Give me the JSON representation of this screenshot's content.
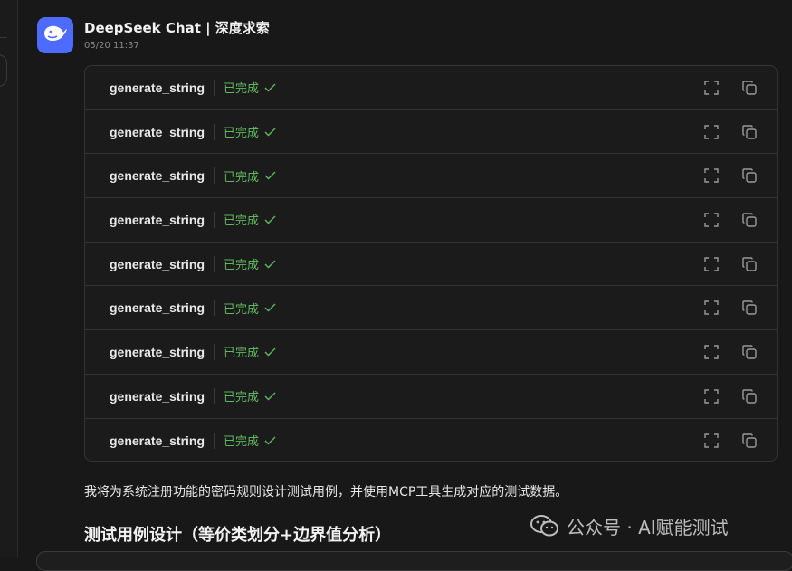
{
  "header": {
    "title": "DeepSeek Chat | 深度求索",
    "timestamp": "05/20 11:37"
  },
  "tool_calls": [
    {
      "name": "generate_string",
      "status": "已完成"
    },
    {
      "name": "generate_string",
      "status": "已完成"
    },
    {
      "name": "generate_string",
      "status": "已完成"
    },
    {
      "name": "generate_string",
      "status": "已完成"
    },
    {
      "name": "generate_string",
      "status": "已完成"
    },
    {
      "name": "generate_string",
      "status": "已完成"
    },
    {
      "name": "generate_string",
      "status": "已完成"
    },
    {
      "name": "generate_string",
      "status": "已完成"
    },
    {
      "name": "generate_string",
      "status": "已完成"
    }
  ],
  "message": {
    "paragraph": "我将为系统注册功能的密码规则设计测试用例，并使用MCP工具生成对应的测试数据。",
    "heading": "测试用例设计（等价类划分+边界值分析）"
  },
  "watermark": {
    "text": "公众号 · AI赋能测试"
  },
  "colors": {
    "accent": "#4d6bfe",
    "status_done": "#5fb85f",
    "background": "#181818",
    "card_border": "#333333"
  },
  "icons": {
    "avatar": "deepseek-whale-icon",
    "status": "check-icon",
    "expand": "expand-icon",
    "copy": "copy-icon",
    "watermark": "wechat-icon"
  }
}
